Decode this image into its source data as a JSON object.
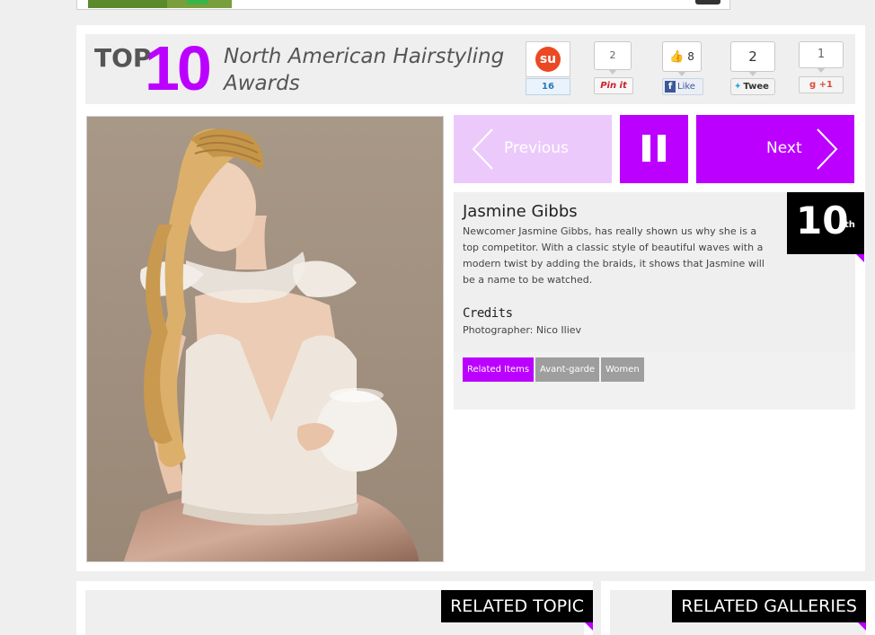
{
  "header": {
    "top_word": "TOP",
    "top_number": "10",
    "title": "North American Hairstyling Awards"
  },
  "social": {
    "stumbleupon": {
      "count": "16",
      "icon": "stumbleupon-icon"
    },
    "pinterest": {
      "count": "2",
      "button_label": "Pin it"
    },
    "facebook": {
      "count": "8",
      "button_label": "Like"
    },
    "twitter": {
      "count": "2",
      "button_label": "Twee"
    },
    "googleplus": {
      "count": "1",
      "button_label": "+1"
    }
  },
  "nav": {
    "previous_label": "Previous",
    "next_label": "Next"
  },
  "entry": {
    "name": "Jasmine Gibbs",
    "description": "Newcomer Jasmine Gibbs, has really shown us why she is a top competitor. With a classic style of beautiful waves with a modern twist by adding the braids, it shows that Jasmine will be a name to be watched.",
    "credits_heading": "Credits",
    "credits_line": "Photographer: Nico Iliev",
    "rank_number": "10",
    "rank_suffix": "th",
    "tags": [
      "Related Items",
      "Avant-garde",
      "Women"
    ]
  },
  "bottom": {
    "related_topic": "RELATED TOPIC",
    "related_galleries": "RELATED GALLERIES"
  },
  "colors": {
    "accent": "#bb00ff",
    "accent_light": "#ecc9fb",
    "tag_gray": "#9e9e9e",
    "background": "#efefef"
  }
}
